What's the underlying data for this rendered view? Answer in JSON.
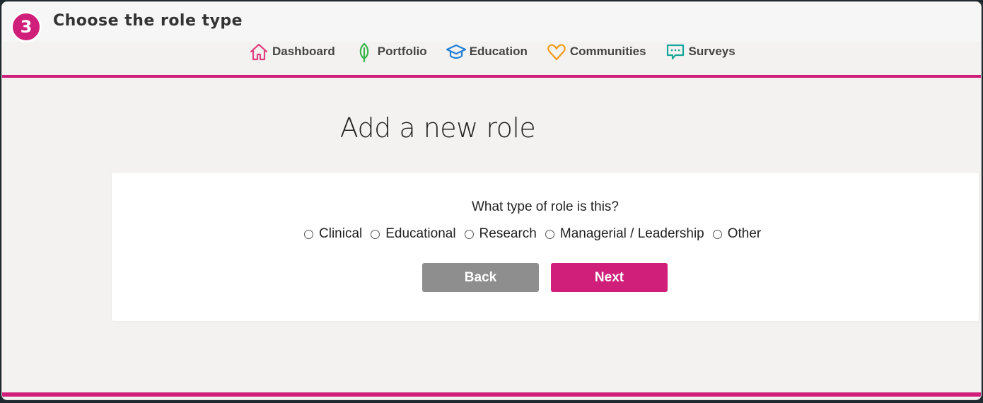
{
  "step": {
    "number": "3",
    "title": "Choose the role type"
  },
  "nav": {
    "items": [
      {
        "label": "Dashboard",
        "icon": "home-icon",
        "color": "#e0407f"
      },
      {
        "label": "Portfolio",
        "icon": "leaf-icon",
        "color": "#39b54a"
      },
      {
        "label": "Education",
        "icon": "graduation-cap-icon",
        "color": "#1e7fd6"
      },
      {
        "label": "Communities",
        "icon": "heart-icon",
        "color": "#f39a1e"
      },
      {
        "label": "Surveys",
        "icon": "chat-bubble-icon",
        "color": "#14a79b"
      }
    ]
  },
  "main": {
    "page_title": "Add a new role",
    "question": "What type of role is this?",
    "options": [
      {
        "label": "Clinical",
        "selected": false
      },
      {
        "label": "Educational",
        "selected": false
      },
      {
        "label": "Research",
        "selected": false
      },
      {
        "label": "Managerial / Leadership",
        "selected": false
      },
      {
        "label": "Other",
        "selected": false
      }
    ],
    "back_label": "Back",
    "next_label": "Next"
  },
  "colors": {
    "accent": "#cf1f7a",
    "back_button": "#8e8e8e",
    "background": "#f4f2f1"
  }
}
